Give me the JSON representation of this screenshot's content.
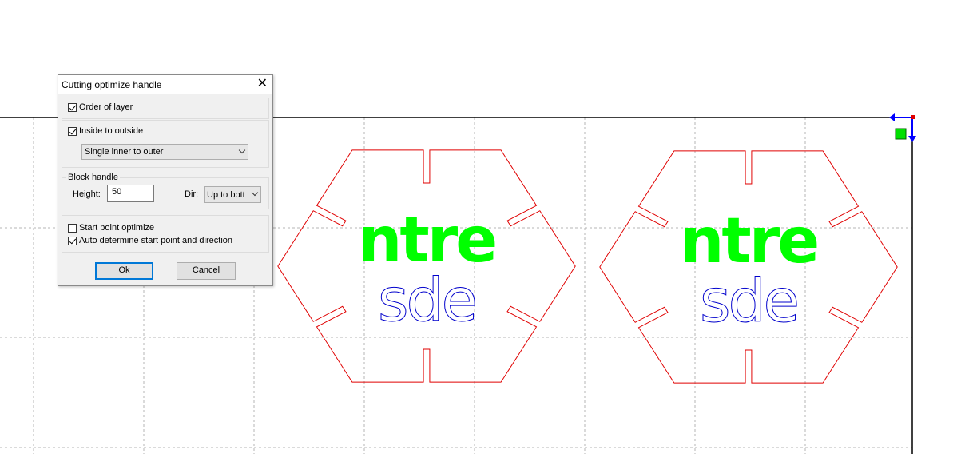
{
  "dialog": {
    "title": "Cutting optimize handle",
    "order_of_layer": {
      "label": "Order of layer",
      "checked": true
    },
    "inside_to_outside": {
      "label": "Inside to outside",
      "checked": true
    },
    "inner_mode": {
      "selected": "Single inner to outer"
    },
    "block_handle": {
      "group_label": "Block handle",
      "height_label": "Height:",
      "height_value": "50",
      "dir_label": "Dir:",
      "dir_selected": "Up to bott"
    },
    "start_point_optimize": {
      "label": "Start point optimize",
      "checked": false
    },
    "auto_determine": {
      "label": "Auto determine start point and direction",
      "checked": true
    },
    "ok_label": "Ok",
    "cancel_label": "Cancel"
  },
  "canvas": {
    "artwork": [
      {
        "top_text": "ntre",
        "bottom_text": "sde"
      },
      {
        "top_text": "ntre",
        "bottom_text": "sde"
      }
    ]
  },
  "colors": {
    "cut_outline": "#e00000",
    "top_text_fill": "#00ff00",
    "bottom_text_outline": "#0000cc",
    "grid": "#b4b4b4",
    "origin_marker": "#00e000",
    "axis_arrow": "#0000ff"
  }
}
